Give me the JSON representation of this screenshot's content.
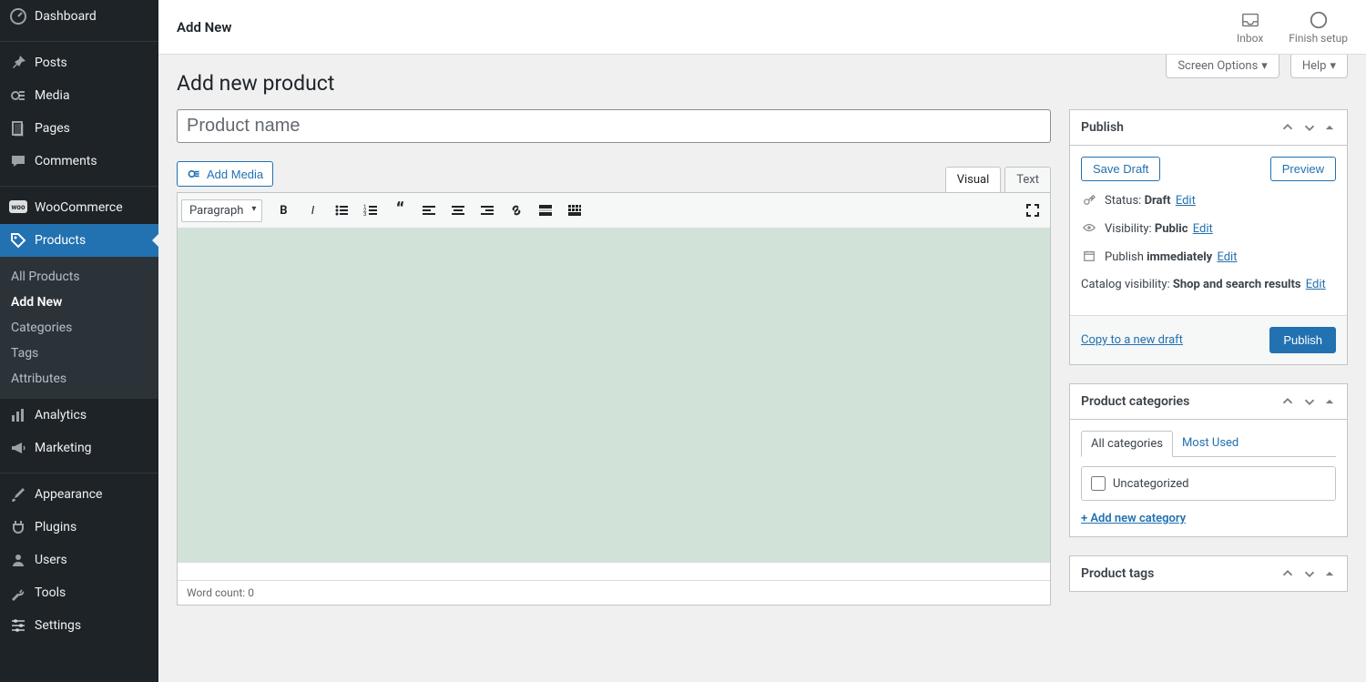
{
  "sidebar": {
    "dashboard": "Dashboard",
    "posts": "Posts",
    "media": "Media",
    "pages": "Pages",
    "comments": "Comments",
    "woocommerce": "WooCommerce",
    "products": "Products",
    "analytics": "Analytics",
    "marketing": "Marketing",
    "appearance": "Appearance",
    "plugins": "Plugins",
    "users": "Users",
    "tools": "Tools",
    "settings": "Settings",
    "products_sub": {
      "all": "All Products",
      "add": "Add New",
      "categories": "Categories",
      "tags": "Tags",
      "attributes": "Attributes"
    }
  },
  "topbar": {
    "title": "Add New",
    "inbox": "Inbox",
    "finish": "Finish setup"
  },
  "screen": {
    "options": "Screen Options",
    "help": "Help"
  },
  "page": {
    "heading": "Add new product",
    "title_placeholder": "Product name"
  },
  "editor": {
    "add_media": "Add Media",
    "visual": "Visual",
    "text": "Text",
    "para": "Paragraph",
    "wordcount_label": "Word count: ",
    "wordcount": "0"
  },
  "publish": {
    "title": "Publish",
    "save_draft": "Save Draft",
    "preview": "Preview",
    "status_label": "Status:",
    "status_value": "Draft",
    "visibility_label": "Visibility:",
    "visibility_value": "Public",
    "publish_label": "Publish",
    "publish_value": "immediately",
    "catalog_label": "Catalog visibility:",
    "catalog_value": "Shop and search results",
    "edit": "Edit",
    "copy": "Copy to a new draft",
    "publish_btn": "Publish"
  },
  "categories": {
    "title": "Product categories",
    "all_tab": "All categories",
    "most_used": "Most Used",
    "uncategorized": "Uncategorized",
    "add_new": "+ Add new category"
  },
  "tags": {
    "title": "Product tags"
  }
}
